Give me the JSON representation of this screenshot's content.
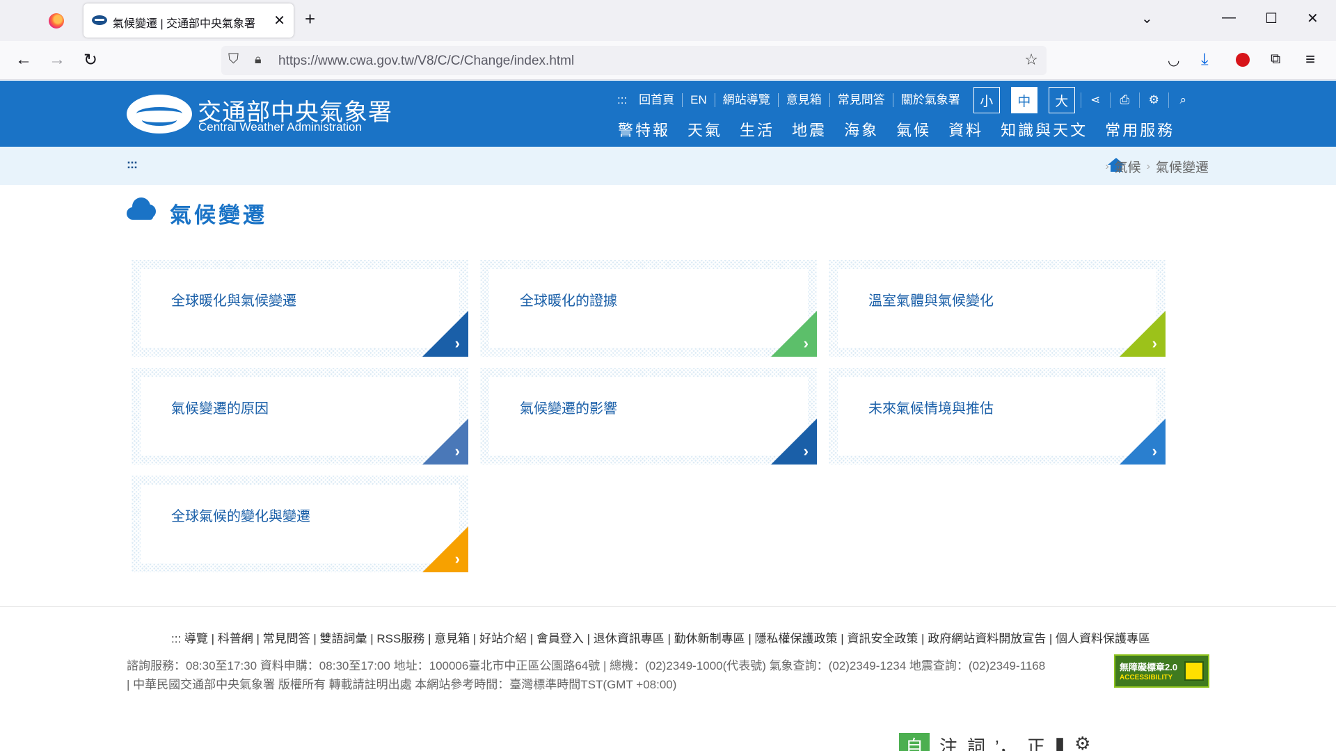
{
  "browser": {
    "tab_title": "氣候變遷 | 交通部中央氣象署",
    "tab_close": "✕",
    "new_tab": "+",
    "url": "https://www.cwa.gov.tw/V8/C/C/Change/index.html",
    "icons": [
      "firefox-logo",
      "back-arrow",
      "forward-arrow",
      "reload",
      "shield",
      "lock",
      "bookmark-star",
      "pocket",
      "download",
      "extension-red",
      "puzzle",
      "menu",
      "tab-list",
      "minimize",
      "maximize",
      "close"
    ]
  },
  "header": {
    "logo_cn": "交通部中央氣象署",
    "logo_en": "Central Weather Administration",
    "utility_accesskey": ":::",
    "utility_links": [
      "回首頁",
      "EN",
      "網站導覽",
      "意見箱",
      "常見問答",
      "關於氣象署"
    ],
    "font_sizes": [
      "小",
      "中",
      "大"
    ],
    "active_font_size": "中",
    "main_nav": [
      "警特報",
      "天氣",
      "生活",
      "地震",
      "海象",
      "氣候",
      "資料",
      "知識與天文",
      "常用服務"
    ]
  },
  "breadcrumb": {
    "accesskey": ":::",
    "items": [
      "氣候",
      "氣候變遷"
    ]
  },
  "page": {
    "title": "氣候變遷"
  },
  "cards": [
    {
      "label": "全球暖化與氣候變遷",
      "color": "#1a5fa8"
    },
    {
      "label": "全球暖化的證據",
      "color": "#5cbf6a"
    },
    {
      "label": "溫室氣體與氣候變化",
      "color": "#9cc21a"
    },
    {
      "label": "氣候變遷的原因",
      "color": "#4a78b8"
    },
    {
      "label": "氣候變遷的影響",
      "color": "#1a5fa8"
    },
    {
      "label": "未來氣候情境與推估",
      "color": "#2a7fcf"
    },
    {
      "label": "全球氣候的變化與變遷",
      "color": "#f7a100"
    }
  ],
  "footer": {
    "links_text": "::: 導覽 | 科普網 | 常見問答 | 雙語詞彙 | RSS服務 | 意見箱 | 好站介紹 | 會員登入 | 退休資訊專區 | 勤休新制專區 | 隱私權保護政策 | 資訊安全政策 | 政府網站資料開放宣告 | 個人資料保護專區",
    "info_line1": "諮詢服務：08:30至17:30 資料申購：08:30至17:00 地址：100006臺北市中正區公園路64號 | 總機：(02)2349-1000(代表號) 氣象查詢：(02)2349-1234 地震查詢：(02)2349-1168",
    "info_line2": "| 中華民國交通部中央氣象署 版權所有 轉載請註明出處 本網站參考時間：臺灣標準時間TST(GMT +08:00)",
    "badge_line1": "無障礙標章2.0",
    "badge_line2": "ACCESSIBILITY"
  },
  "bottom_toolbar": [
    "自",
    "注",
    "詞",
    "’，",
    "正",
    "▮",
    "⚙"
  ]
}
